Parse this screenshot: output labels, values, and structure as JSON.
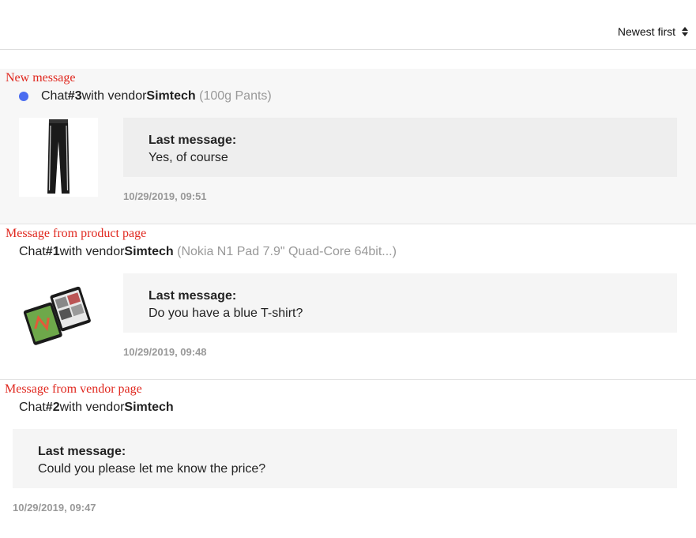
{
  "sort": {
    "label": "Newest first"
  },
  "chats": [
    {
      "annotation": "New message",
      "prefix": "Chat ",
      "number": "#3",
      "middle": " with vendor ",
      "vendor": "Simtech",
      "product": "(100g Pants)",
      "last_message_label": "Last message:",
      "last_message": "Yes, of course",
      "timestamp": "10/29/2019, 09:51"
    },
    {
      "annotation": "Message from product page",
      "prefix": "Chat ",
      "number": "#1",
      "middle": " with vendor ",
      "vendor": "Simtech",
      "product": "(Nokia N1 Pad 7.9\" Quad-Core 64bit...)",
      "last_message_label": "Last message:",
      "last_message": "Do you have a blue T-shirt?",
      "timestamp": "10/29/2019, 09:48"
    },
    {
      "annotation": "Message from vendor page",
      "prefix": "Chat ",
      "number": "#2",
      "middle": " with vendor ",
      "vendor": "Simtech",
      "last_message_label": "Last message:",
      "last_message": "Could you please let me know the price?",
      "timestamp": "10/29/2019, 09:47"
    }
  ],
  "colors": {
    "unread_dot": "#4a6cf0",
    "annotation": "#e0281f"
  }
}
